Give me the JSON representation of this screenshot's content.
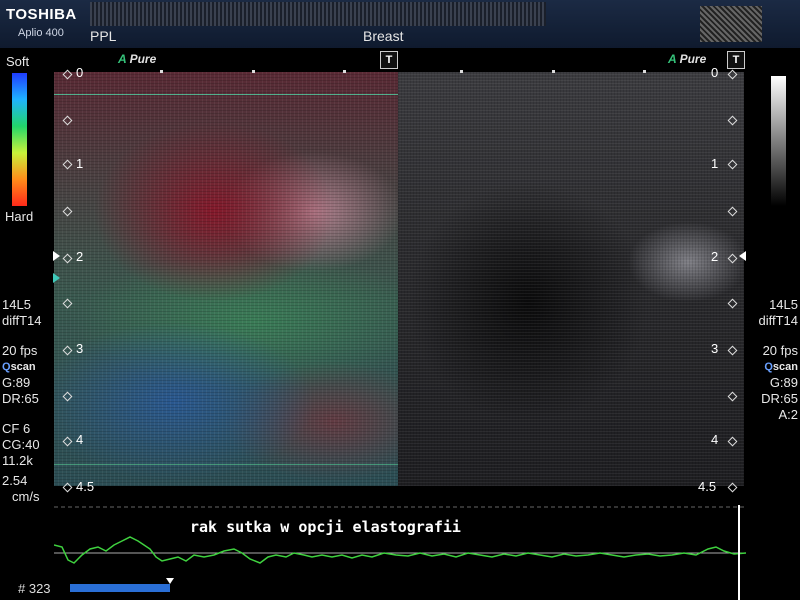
{
  "header": {
    "brand": "TOSHIBA",
    "model": "Aplio 400",
    "mode_label": "PPL",
    "preset": "Breast"
  },
  "top_row": {
    "left_apure_a": "A",
    "left_apure_text": "Pure",
    "left_t": "T",
    "right_apure_a": "A",
    "right_apure_text": "Pure",
    "right_t": "T"
  },
  "color_scale": {
    "soft_label": "Soft",
    "hard_label": "Hard"
  },
  "depth_scale": {
    "left": [
      "0",
      "1",
      "2",
      "3",
      "4",
      "4.5"
    ],
    "right": [
      "0",
      "1",
      "2",
      "3",
      "4",
      "4.5"
    ]
  },
  "left_params": {
    "probe": "14L5",
    "mode": "diffT14",
    "fps": "20 fps",
    "qscan_q": "Q",
    "qscan_text": "scan",
    "gain": "G:89",
    "dr": "DR:65",
    "cf": "CF 6",
    "cg": "CG:40",
    "prf": "11.2k",
    "velocity": "2.54",
    "velocity_unit": "cm/s"
  },
  "right_params": {
    "probe": "14L5",
    "mode": "diffT14",
    "fps": "20 fps",
    "qscan_q": "Q",
    "qscan_text": "scan",
    "gain": "G:89",
    "dr": "DR:65",
    "a": "A:2"
  },
  "caption": "rak sutka w opcji elastografii",
  "cine": {
    "frame": "# 323"
  },
  "colors": {
    "background": "#000000",
    "header": "#1b2a44",
    "ecg": "#3fd13f",
    "cine_bar": "#2a6fd6"
  }
}
